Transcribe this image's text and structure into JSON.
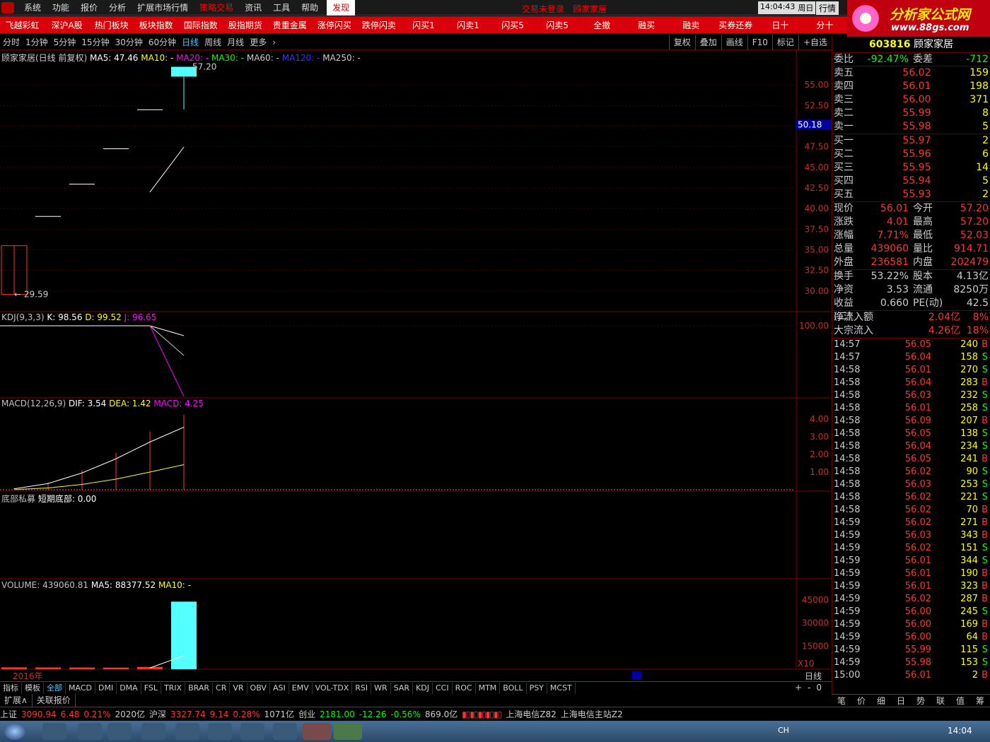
{
  "menu": {
    "items": [
      "系统",
      "功能",
      "报价",
      "分析",
      "扩展市场行情",
      "策略交易",
      "资讯",
      "工具",
      "帮助"
    ],
    "active": "发现",
    "login_status": "交易未登录",
    "stock_name_top": "顾家家居",
    "time": "14:04:43",
    "weekday": "周日",
    "quote_btn": "行情"
  },
  "brand": {
    "title": "分析家公式网",
    "url": "www.88gs.com"
  },
  "quick": [
    "飞越彩虹",
    "深沪A股",
    "热门板块",
    "板块指数",
    "国际指数",
    "股指期货",
    "贵重金属",
    "涨停闪买",
    "跌停闪卖",
    "闪买1",
    "闪卖1",
    "闪买5",
    "闪卖5",
    "全撤",
    "融买",
    "融卖",
    "买券还券",
    "日十",
    "分十"
  ],
  "periods": [
    "分时",
    "1分钟",
    "5分钟",
    "15分钟",
    "30分钟",
    "60分钟",
    "日线",
    "周线",
    "月线",
    "更多"
  ],
  "selected_period": "日线",
  "right_tools": [
    "复权",
    "叠加",
    "画线",
    "F10",
    "标记",
    "+自选"
  ],
  "main_legend": {
    "title": "顾家家居(日线 前复权)",
    "ma5": "MA5: 47.46",
    "ma10": "MA10: -",
    "ma20": "MA20: -",
    "ma30": "MA30: -",
    "ma60": "MA60: -",
    "ma120": "MA120: -",
    "ma250": "MA250: -"
  },
  "main_axis": [
    "55.00",
    "52.50",
    "50.00",
    "47.50",
    "45.00",
    "42.50",
    "40.00",
    "37.50",
    "35.00",
    "32.50",
    "30.00"
  ],
  "price_marker": "50.18",
  "high_label": "57.20",
  "low_label": "29.59",
  "kdj": {
    "label": "KDJ(9,3,3)",
    "k": "K: 98.56",
    "d": "D: 99.52",
    "j": "J: 96.65",
    "axis": "100.00"
  },
  "macd": {
    "label": "MACD(12,26,9)",
    "dif": "DIF: 3.54",
    "dea": "DEA: 1.42",
    "macd": "MACD: 4.25",
    "axis": [
      "4.00",
      "3.00",
      "2.00",
      "1.00"
    ]
  },
  "bottom": {
    "label": "底部私募",
    "short": "短期底部: 0.00"
  },
  "volume": {
    "label": "VOLUME: 439060.81",
    "ma5": "MA5: 88377.52",
    "ma10": "MA10: -",
    "axis": [
      "45000",
      "30000",
      "15000"
    ],
    "unit": "X10"
  },
  "year_label": "2016年",
  "daily_label": "日线",
  "chart_data": {
    "type": "candlestick",
    "candles": [
      {
        "open": 29.59,
        "high": 35.5,
        "low": 29.59,
        "close": 35.5
      },
      {
        "open": 39.05,
        "high": 39.05,
        "low": 39.05,
        "close": 39.05
      },
      {
        "open": 42.96,
        "high": 42.96,
        "low": 42.96,
        "close": 42.96
      },
      {
        "open": 47.26,
        "high": 47.26,
        "low": 47.26,
        "close": 47.26
      },
      {
        "open": 51.99,
        "high": 51.99,
        "low": 51.99,
        "close": 51.99
      },
      {
        "open": 57.2,
        "high": 57.2,
        "low": 52.03,
        "close": 56.01
      }
    ],
    "volume": [
      1200,
      1150,
      1100,
      1050,
      1500,
      43906
    ],
    "macd_hist": [
      0.1,
      0.4,
      1.1,
      2.1,
      3.3,
      4.25
    ],
    "dif": [
      0.05,
      0.35,
      0.95,
      1.75,
      2.7,
      3.54
    ],
    "dea": [
      0.01,
      0.1,
      0.3,
      0.6,
      1.0,
      1.42
    ]
  },
  "quote": {
    "code": "603816",
    "name": "顾家家居",
    "webi_label": "委比",
    "webi": "-92.47%",
    "weicha_label": "委差",
    "weicha": "-712",
    "sells": [
      {
        "label": "卖五",
        "price": "56.02",
        "vol": "159"
      },
      {
        "label": "卖四",
        "price": "56.01",
        "vol": "198"
      },
      {
        "label": "卖三",
        "price": "56.00",
        "vol": "371"
      },
      {
        "label": "卖二",
        "price": "55.99",
        "vol": "8"
      },
      {
        "label": "卖一",
        "price": "55.98",
        "vol": "5"
      }
    ],
    "buys": [
      {
        "label": "买一",
        "price": "55.97",
        "vol": "2"
      },
      {
        "label": "买二",
        "price": "55.96",
        "vol": "6"
      },
      {
        "label": "买三",
        "price": "55.95",
        "vol": "14"
      },
      {
        "label": "买四",
        "price": "55.94",
        "vol": "5"
      },
      {
        "label": "买五",
        "price": "55.93",
        "vol": "2"
      }
    ],
    "stats": [
      {
        "l1": "现价",
        "v1": "56.01",
        "l2": "今开",
        "v2": "57.20"
      },
      {
        "l1": "涨跌",
        "v1": "4.01",
        "l2": "最高",
        "v2": "57.20"
      },
      {
        "l1": "涨幅",
        "v1": "7.71%",
        "l2": "最低",
        "v2": "52.03"
      },
      {
        "l1": "总量",
        "v1": "439060",
        "l2": "量比",
        "v2": "914.71"
      },
      {
        "l1": "外盘",
        "v1": "236581",
        "l2": "内盘",
        "v2": "202479"
      }
    ],
    "stats2": [
      {
        "l1": "换手",
        "v1": "53.22%",
        "l2": "股本",
        "v2": "4.13亿"
      },
      {
        "l1": "净资",
        "v1": "3.53",
        "l2": "流通",
        "v2": "8250万"
      },
      {
        "l1": "收益(二)",
        "v1": "0.660",
        "l2": "PE(动)",
        "v2": "42.5"
      }
    ],
    "flows": [
      {
        "label": "净流入额",
        "val": "2.04亿",
        "pct": "8%"
      },
      {
        "label": "大宗流入",
        "val": "4.26亿",
        "pct": "18%"
      }
    ]
  },
  "ticks": [
    [
      "14:57",
      "56.05",
      "240",
      "B"
    ],
    [
      "14:57",
      "56.04",
      "158",
      "S"
    ],
    [
      "14:58",
      "56.01",
      "270",
      "S"
    ],
    [
      "14:58",
      "56.04",
      "283",
      "B"
    ],
    [
      "14:58",
      "56.03",
      "232",
      "S"
    ],
    [
      "14:58",
      "56.01",
      "258",
      "S"
    ],
    [
      "14:58",
      "56.09",
      "207",
      "B"
    ],
    [
      "14:58",
      "56.05",
      "138",
      "S"
    ],
    [
      "14:58",
      "56.04",
      "234",
      "S"
    ],
    [
      "14:58",
      "56.05",
      "241",
      "B"
    ],
    [
      "14:58",
      "56.02",
      "90",
      "S"
    ],
    [
      "14:58",
      "56.03",
      "253",
      "S"
    ],
    [
      "14:58",
      "56.02",
      "221",
      "S"
    ],
    [
      "14:58",
      "56.02",
      "70",
      "B"
    ],
    [
      "14:59",
      "56.02",
      "271",
      "B"
    ],
    [
      "14:59",
      "56.03",
      "343",
      "B"
    ],
    [
      "14:59",
      "56.02",
      "151",
      "S"
    ],
    [
      "14:59",
      "56.01",
      "344",
      "S"
    ],
    [
      "14:59",
      "56.01",
      "190",
      "B"
    ],
    [
      "14:59",
      "56.01",
      "323",
      "B"
    ],
    [
      "14:59",
      "56.02",
      "287",
      "B"
    ],
    [
      "14:59",
      "56.00",
      "245",
      "S"
    ],
    [
      "14:59",
      "56.00",
      "169",
      "B"
    ],
    [
      "14:59",
      "56.00",
      "64",
      "B"
    ],
    [
      "14:59",
      "55.99",
      "115",
      "S"
    ],
    [
      "14:59",
      "55.98",
      "153",
      "S"
    ],
    [
      "15:00",
      "56.01",
      "2",
      "B"
    ]
  ],
  "right_tabs": [
    "笔",
    "价",
    "细",
    "日",
    "势",
    "联",
    "值",
    "筹"
  ],
  "indicator_tabs": [
    "指标",
    "模板",
    "全部",
    "MACD",
    "DMI",
    "DMA",
    "FSL",
    "TRIX",
    "BRAR",
    "CR",
    "VR",
    "OBV",
    "ASI",
    "EMV",
    "VOL-TDX",
    "RSI",
    "WR",
    "SAR",
    "KDJ",
    "CCI",
    "ROC",
    "MTM",
    "BOLL",
    "PSY",
    "MCST"
  ],
  "ext_tabs": [
    "扩展∧",
    "关联报价"
  ],
  "zoom_ctrl": [
    "+",
    "-",
    "0"
  ],
  "status": {
    "sh_label": "上证",
    "sh_val": "3090.94",
    "sh_chg": "6.48",
    "sh_pct": "0.21%",
    "sh_amt": "2020亿",
    "hs_label": "沪深",
    "hs_val": "3327.74",
    "hs_chg": "9.14",
    "hs_pct": "0.28%",
    "hs_amt": "1071亿",
    "cy_label": "创业",
    "cy_val": "2181.00",
    "cy_chg": "-12.26",
    "cy_pct": "-0.56%",
    "cy_amt": "869.0亿",
    "server1": "上海电信Z82",
    "server2": "上海电信主站Z2"
  },
  "taskbar": {
    "clock": "14:04",
    "lang": "CH"
  },
  "colors": {
    "up": "#ff3232",
    "down": "#54ffff",
    "menu_red": "#d8000a",
    "grid": "#800000"
  }
}
